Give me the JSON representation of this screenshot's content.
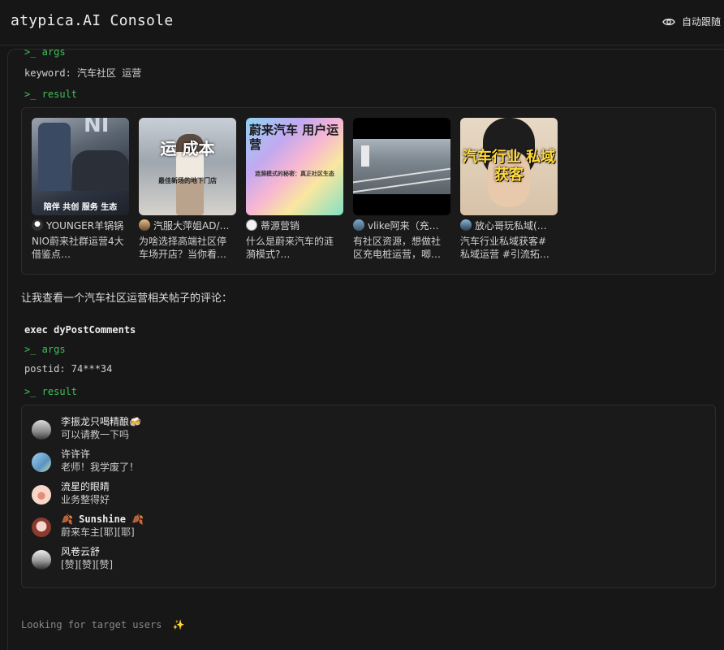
{
  "header": {
    "title": "atypica.AI Console",
    "follow_label": "自动跟随",
    "follow_icon": "eye-icon"
  },
  "call1": {
    "args_tag": ">_ args",
    "args_text": "keyword: 汽车社区 运营",
    "result_tag": ">_ result",
    "posts": [
      {
        "author": "YOUNGER羊锅锅",
        "desc": "NIO蔚来社群运营4大借鉴点…",
        "cover_text": "陪伴 共创 服务 生态"
      },
      {
        "author": "汽服大萍姐AD/…",
        "desc": "为啥选择高端社区停车场开店？当你看…",
        "cover_text": "运 成本",
        "cover_sub": "最佳新场的地下门店"
      },
      {
        "author": "蒂源营销",
        "desc": "什么是蔚来汽车的涟漪模式?…",
        "cover_text": "蔚来汽车 用户运营",
        "cover_sub": "涟漪模式的秘密：真正社区生态"
      },
      {
        "author": "vlike阿来（充…",
        "desc": "有社区资源，想做社区充电桩运营，唧…",
        "cover_text": ""
      },
      {
        "author": "放心哥玩私域(…",
        "desc": "汽车行业私域获客#私域运营 #引流拓…",
        "cover_text": "汽车行业 私域获客"
      }
    ]
  },
  "prose": "让我查看一个汽车社区运营相关帖子的评论：",
  "call2": {
    "exec_label": "exec dyPostComments",
    "args_tag": ">_ args",
    "args_text": "postid: 74***34",
    "result_tag": ">_ result",
    "comments": [
      {
        "name": "李振龙只喝精酿🍻",
        "text": "可以请教一下吗"
      },
      {
        "name": "许许许",
        "text": "老师！我学废了！"
      },
      {
        "name": "流星的眼睛",
        "text": "业务整得好"
      },
      {
        "name": "🍂 Sunshine 🍂",
        "text": "蔚来车主[耶][耶]"
      },
      {
        "name": "风卷云舒",
        "text": "[赞][赞][赞]"
      }
    ]
  },
  "footer": {
    "status": "Looking for target users",
    "sparkle": "✨"
  }
}
